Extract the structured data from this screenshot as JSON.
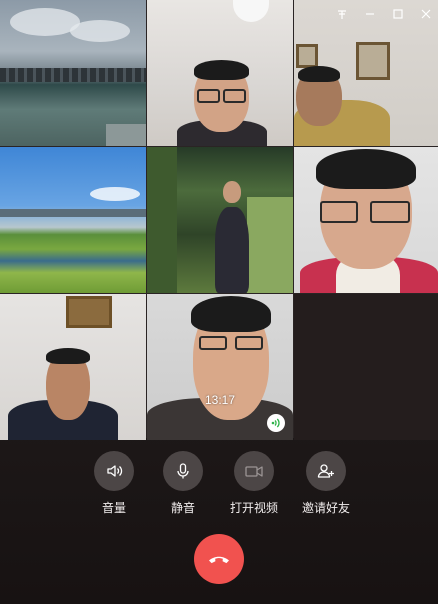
{
  "call": {
    "timer": "13:17"
  },
  "titlebar": {
    "pin_icon": "pin-icon",
    "minimize_icon": "minimize-icon",
    "maximize_icon": "maximize-icon",
    "close_icon": "close-icon"
  },
  "controls": {
    "volume_label": "音量",
    "mute_label": "静音",
    "video_label": "打开视频",
    "invite_label": "邀请好友"
  },
  "colors": {
    "hangup": "#f1524f",
    "control_bg": "#4c4646",
    "speaking_indicator": "#2fb34a"
  }
}
